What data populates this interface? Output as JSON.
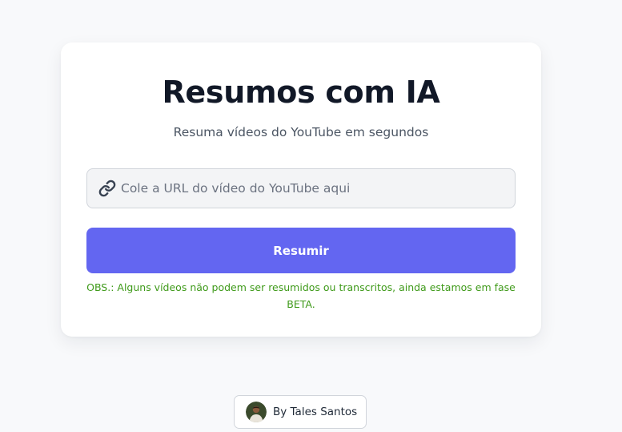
{
  "header": {
    "title": "Resumos com IA",
    "subtitle": "Resuma vídeos do YouTube em segundos"
  },
  "form": {
    "url_input": {
      "placeholder": "Cole a URL do vídeo do YouTube aqui",
      "value": "",
      "icon": "link-icon"
    },
    "submit_label": "Resumir",
    "note": "OBS.: Alguns vídeos não podem ser resumidos ou transcritos, ainda estamos em fase BETA."
  },
  "footer": {
    "credit": "By Tales Santos",
    "avatar_icon": "avatar"
  },
  "colors": {
    "background": "#f8f9fb",
    "card": "#ffffff",
    "accent": "#6366f1",
    "note": "#3f9a1a",
    "title": "#111827"
  }
}
